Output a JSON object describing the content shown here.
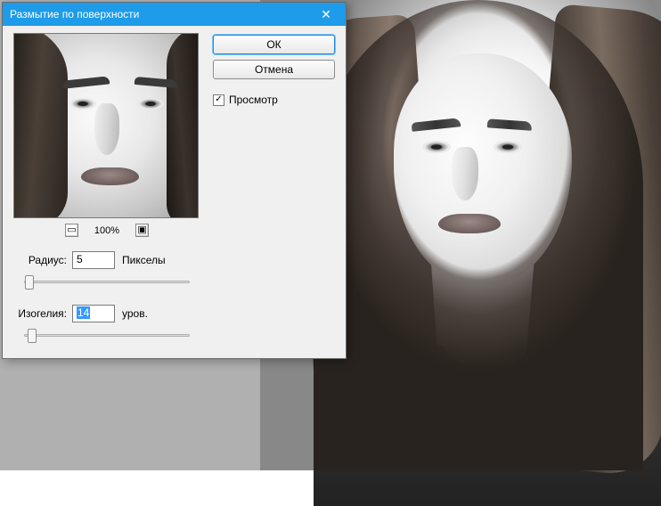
{
  "dialog": {
    "title": "Размытие по поверхности",
    "ok_label": "ОК",
    "cancel_label": "Отмена",
    "preview_checkbox_label": "Просмотр",
    "preview_checked": true,
    "zoom": {
      "minus_icon": "minus-icon",
      "plus_icon": "plus-icon",
      "value": "100%"
    },
    "radius": {
      "label": "Радиус:",
      "value": "5",
      "unit": "Пикселы",
      "slider_percent": 3
    },
    "threshold": {
      "label": "Изогелия:",
      "value": "14",
      "unit": "уров.",
      "slider_percent": 5,
      "selected": true
    }
  }
}
